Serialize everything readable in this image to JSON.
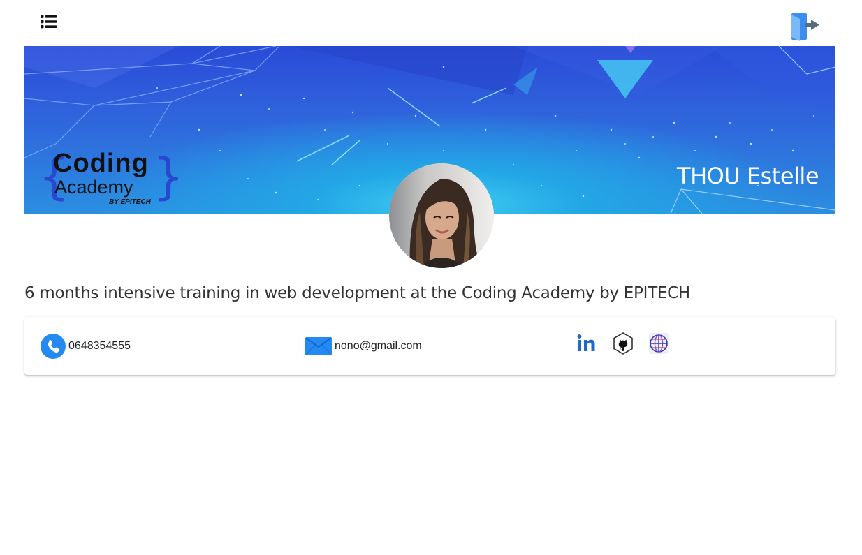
{
  "header": {
    "menu_icon": "list-icon",
    "logout_icon": "logout-icon"
  },
  "banner": {
    "logo": {
      "line1": "Cᴏding",
      "line2": "Academy",
      "line3": "BY EPITECH"
    },
    "name": "THOU Estelle"
  },
  "profile": {
    "description": "6 months intensive training in web development at the Coding Academy by EPITECH"
  },
  "contact": {
    "phone": "0648354555",
    "email": "nono@gmail.com",
    "socials": [
      {
        "icon": "linkedin-icon"
      },
      {
        "icon": "github-icon"
      },
      {
        "icon": "globe-icon"
      }
    ]
  },
  "colors": {
    "accent_blue": "#2489f0",
    "banner_top": "#2a4bd8",
    "banner_glow": "#3fcdf0"
  }
}
